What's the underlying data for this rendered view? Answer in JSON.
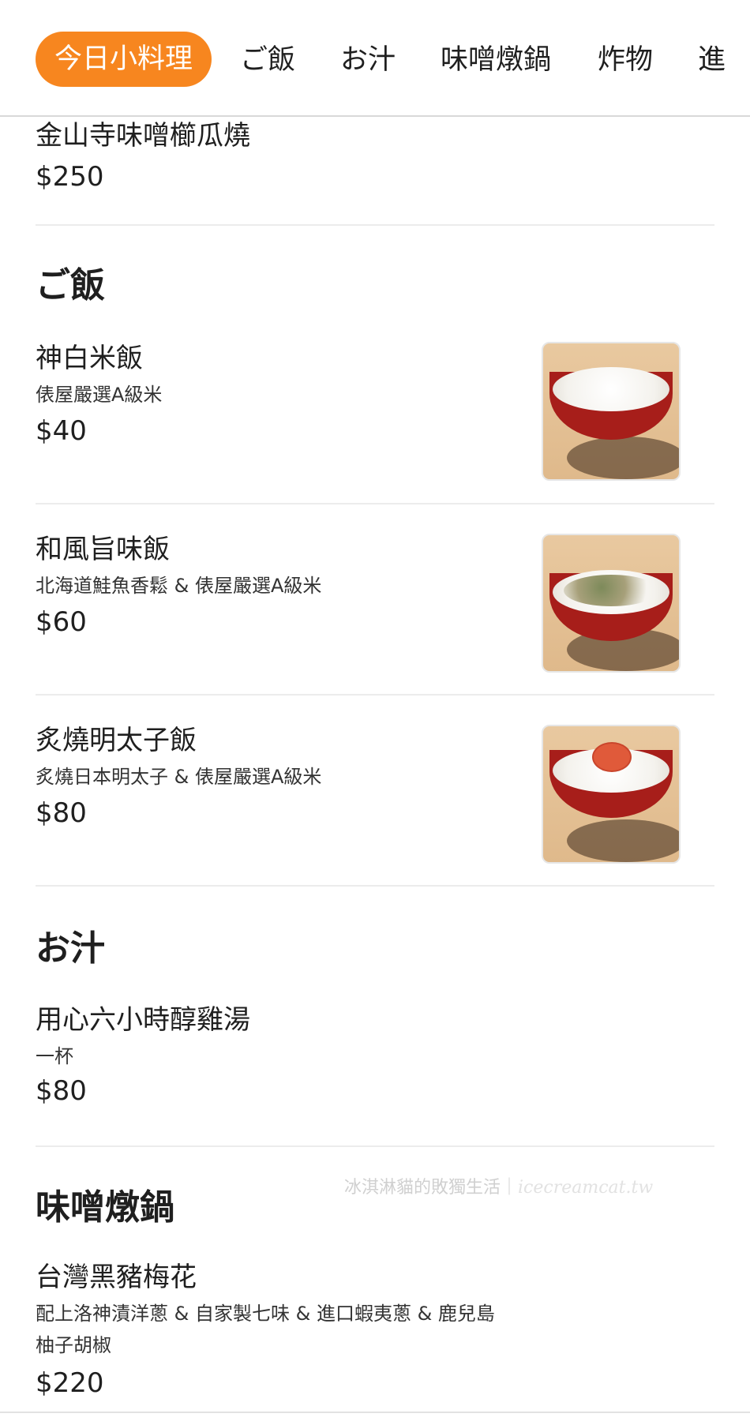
{
  "tabs": [
    {
      "label": "今日小料理",
      "active": true
    },
    {
      "label": "ご飯",
      "active": false
    },
    {
      "label": "お汁",
      "active": false
    },
    {
      "label": "味噌燉鍋",
      "active": false
    },
    {
      "label": "炸物",
      "active": false
    },
    {
      "label": "進",
      "active": false
    }
  ],
  "colors": {
    "accent": "#f7861f"
  },
  "menu": {
    "prev_item": {
      "name": "金山寺味噌櫛瓜燒",
      "price": "$250"
    },
    "sections": [
      {
        "title": "ご飯",
        "items": [
          {
            "name": "神白米飯",
            "desc": "俵屋嚴選A級米",
            "price": "$40",
            "image": "rice-bowl-image"
          },
          {
            "name": "和風旨味飯",
            "desc": "北海道鮭魚香鬆 & 俵屋嚴選A級米",
            "price": "$60",
            "image": "salmon-furikake-rice-image"
          },
          {
            "name": "炙燒明太子飯",
            "desc": "炙燒日本明太子 & 俵屋嚴選A級米",
            "price": "$80",
            "image": "mentaiko-rice-image"
          }
        ]
      },
      {
        "title": "お汁",
        "items": [
          {
            "name": "用心六小時醇雞湯",
            "desc": "一杯",
            "price": "$80"
          }
        ]
      },
      {
        "title": "味噌燉鍋",
        "items": [
          {
            "name": "台灣黑豬梅花",
            "desc_line1": "配上洛神漬洋蔥 & 自家製七味 & 進口蝦夷蔥 &  鹿兒島",
            "desc_line2": "柚子胡椒",
            "price": "$220"
          }
        ]
      }
    ]
  },
  "watermark": {
    "text": "冰淇淋貓的敗獨生活｜",
    "url": "icecreamcat.tw"
  }
}
